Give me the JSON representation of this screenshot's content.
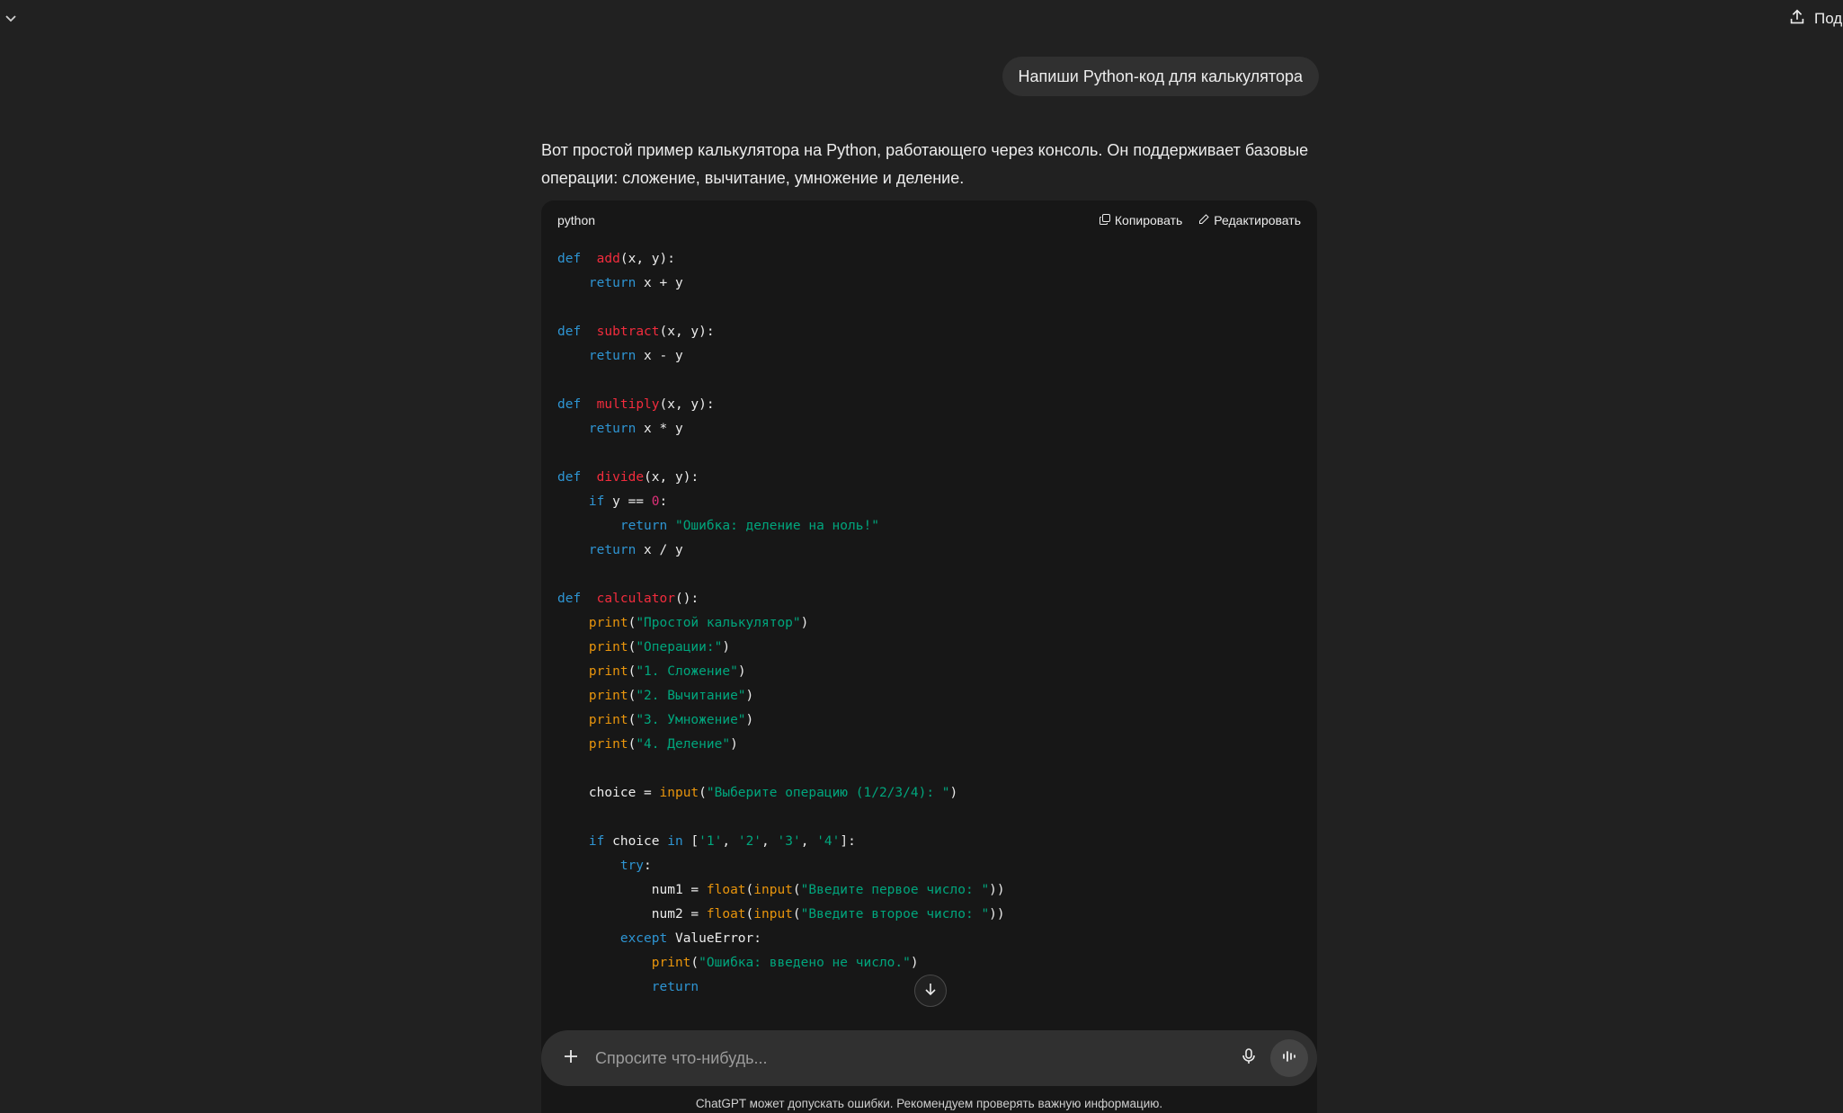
{
  "header": {
    "share_label": "Поделиться"
  },
  "conversation": {
    "user_message": "Напиши Python-код для калькулятора",
    "assistant_intro": "Вот простой пример калькулятора на Python, работающего через консоль. Он поддерживает базовые операции: сложение, вычитание, умножение и деление.",
    "code_block": {
      "language": "python",
      "copy_label": "Копировать",
      "edit_label": "Редактировать",
      "lines": [
        [
          [
            "kw",
            "def"
          ],
          [
            "",
            "  "
          ],
          [
            "fn",
            "add"
          ],
          [
            "",
            "(x, y):"
          ]
        ],
        [
          [
            "",
            "    "
          ],
          [
            "kw",
            "return"
          ],
          [
            "",
            " x + y"
          ]
        ],
        [],
        [
          [
            "kw",
            "def"
          ],
          [
            "",
            "  "
          ],
          [
            "fn",
            "subtract"
          ],
          [
            "",
            "(x, y):"
          ]
        ],
        [
          [
            "",
            "    "
          ],
          [
            "kw",
            "return"
          ],
          [
            "",
            " x - y"
          ]
        ],
        [],
        [
          [
            "kw",
            "def"
          ],
          [
            "",
            "  "
          ],
          [
            "fn",
            "multiply"
          ],
          [
            "",
            "(x, y):"
          ]
        ],
        [
          [
            "",
            "    "
          ],
          [
            "kw",
            "return"
          ],
          [
            "",
            " x * y"
          ]
        ],
        [],
        [
          [
            "kw",
            "def"
          ],
          [
            "",
            "  "
          ],
          [
            "fn",
            "divide"
          ],
          [
            "",
            "(x, y):"
          ]
        ],
        [
          [
            "",
            "    "
          ],
          [
            "kw",
            "if"
          ],
          [
            "",
            " y == "
          ],
          [
            "nu",
            "0"
          ],
          [
            "",
            ":"
          ]
        ],
        [
          [
            "",
            "        "
          ],
          [
            "kw",
            "return"
          ],
          [
            "st",
            " \"Ошибка: деление на ноль!\""
          ]
        ],
        [
          [
            "",
            "    "
          ],
          [
            "kw",
            "return"
          ],
          [
            "",
            " x / y"
          ]
        ],
        [],
        [
          [
            "kw",
            "def"
          ],
          [
            "",
            "  "
          ],
          [
            "fn",
            "calculator"
          ],
          [
            "",
            "():"
          ]
        ],
        [
          [
            "",
            "    "
          ],
          [
            "nb",
            "print"
          ],
          [
            "",
            "("
          ],
          [
            "st",
            "\"Простой калькулятор\""
          ],
          [
            "",
            ")"
          ]
        ],
        [
          [
            "",
            "    "
          ],
          [
            "nb",
            "print"
          ],
          [
            "",
            "("
          ],
          [
            "st",
            "\"Операции:\""
          ],
          [
            "",
            ")"
          ]
        ],
        [
          [
            "",
            "    "
          ],
          [
            "nb",
            "print"
          ],
          [
            "",
            "("
          ],
          [
            "st",
            "\"1. Сложение\""
          ],
          [
            "",
            ")"
          ]
        ],
        [
          [
            "",
            "    "
          ],
          [
            "nb",
            "print"
          ],
          [
            "",
            "("
          ],
          [
            "st",
            "\"2. Вычитание\""
          ],
          [
            "",
            ")"
          ]
        ],
        [
          [
            "",
            "    "
          ],
          [
            "nb",
            "print"
          ],
          [
            "",
            "("
          ],
          [
            "st",
            "\"3. Умножение\""
          ],
          [
            "",
            ")"
          ]
        ],
        [
          [
            "",
            "    "
          ],
          [
            "nb",
            "print"
          ],
          [
            "",
            "("
          ],
          [
            "st",
            "\"4. Деление\""
          ],
          [
            "",
            ")"
          ]
        ],
        [],
        [
          [
            "",
            "    choice = "
          ],
          [
            "nb",
            "input"
          ],
          [
            "",
            "("
          ],
          [
            "st",
            "\"Выберите операцию (1/2/3/4): \""
          ],
          [
            "",
            ")"
          ]
        ],
        [],
        [
          [
            "",
            "    "
          ],
          [
            "kw",
            "if"
          ],
          [
            "",
            " choice "
          ],
          [
            "kw",
            "in"
          ],
          [
            "",
            " ["
          ],
          [
            "st",
            "'1'"
          ],
          [
            "",
            ", "
          ],
          [
            "st",
            "'2'"
          ],
          [
            "",
            ", "
          ],
          [
            "st",
            "'3'"
          ],
          [
            "",
            ", "
          ],
          [
            "st",
            "'4'"
          ],
          [
            "",
            "]:"
          ]
        ],
        [
          [
            "",
            "        "
          ],
          [
            "kw",
            "try"
          ],
          [
            "",
            ":"
          ]
        ],
        [
          [
            "",
            "            num1 = "
          ],
          [
            "nb",
            "float"
          ],
          [
            "",
            "("
          ],
          [
            "nb",
            "input"
          ],
          [
            "",
            "("
          ],
          [
            "st",
            "\"Введите первое число: \""
          ],
          [
            "",
            "))"
          ]
        ],
        [
          [
            "",
            "            num2 = "
          ],
          [
            "nb",
            "float"
          ],
          [
            "",
            "("
          ],
          [
            "nb",
            "input"
          ],
          [
            "",
            "("
          ],
          [
            "st",
            "\"Введите второе число: \""
          ],
          [
            "",
            "))"
          ]
        ],
        [
          [
            "",
            "        "
          ],
          [
            "kw",
            "except"
          ],
          [
            "",
            " ValueError:"
          ]
        ],
        [
          [
            "",
            "            "
          ],
          [
            "nb",
            "print"
          ],
          [
            "",
            "("
          ],
          [
            "st",
            "\"Ошибка: введено не число.\""
          ],
          [
            "",
            ")"
          ]
        ],
        [
          [
            "",
            "            "
          ],
          [
            "kw",
            "return"
          ]
        ]
      ]
    }
  },
  "composer": {
    "placeholder": "Спросите что-нибудь..."
  },
  "footer": {
    "disclaimer": "ChatGPT может допускать ошибки. Рекомендуем проверять важную информацию."
  }
}
